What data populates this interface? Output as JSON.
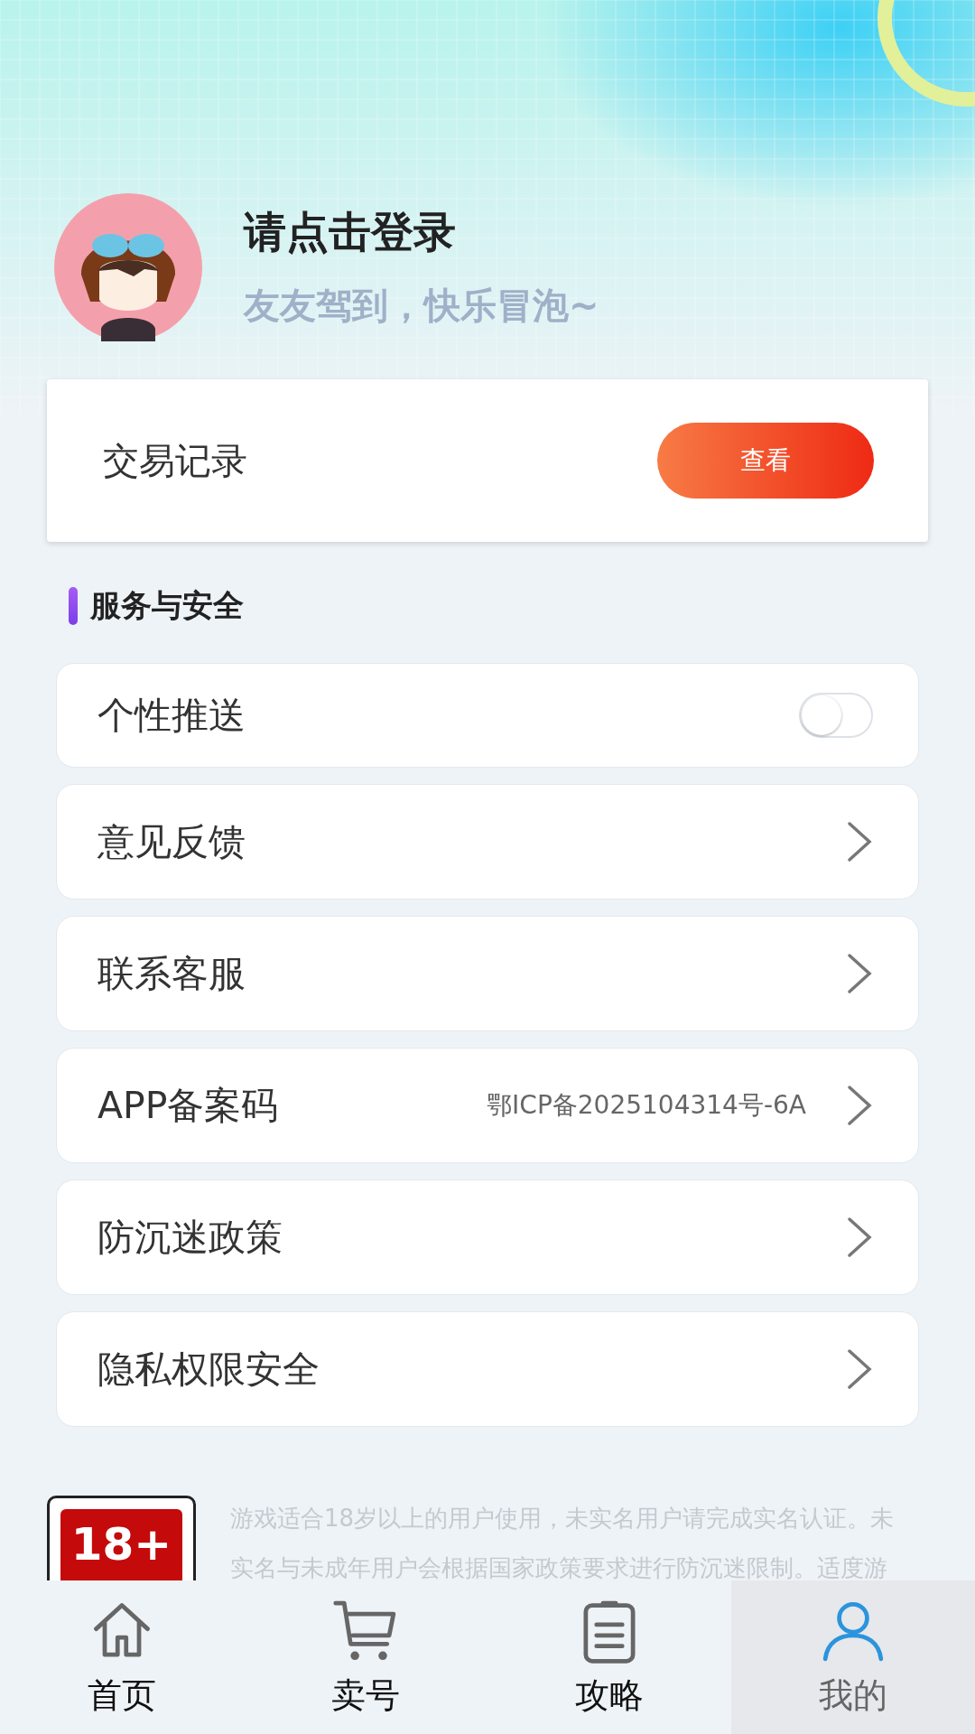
{
  "profile": {
    "title": "请点击登录",
    "subtitle": "友友驾到，快乐冒泡~"
  },
  "trade": {
    "label": "交易记录",
    "button": "查看"
  },
  "section": {
    "title": "服务与安全"
  },
  "rows": [
    {
      "kind": "toggle",
      "label": "个性推送",
      "on": false
    },
    {
      "kind": "link",
      "label": "意见反馈"
    },
    {
      "kind": "link",
      "label": "联系客服"
    },
    {
      "kind": "link",
      "label": "APP备案码",
      "value": "鄂ICP备2025104314号-6A"
    },
    {
      "kind": "link",
      "label": "防沉迷政策"
    },
    {
      "kind": "link",
      "label": "隐私权限安全"
    }
  ],
  "notice": {
    "badge": "18+",
    "lines": [
      "游戏适合18岁以上的用户使用，未实名用户请完成实名认证。未",
      "实名与未成年用户会根据国家政策要求进行防沉迷限制。适度游"
    ]
  },
  "tabs": [
    {
      "label": "首页",
      "selected": false
    },
    {
      "label": "卖号",
      "selected": false
    },
    {
      "label": "攻略",
      "selected": false
    },
    {
      "label": "我的",
      "selected": true
    }
  ]
}
